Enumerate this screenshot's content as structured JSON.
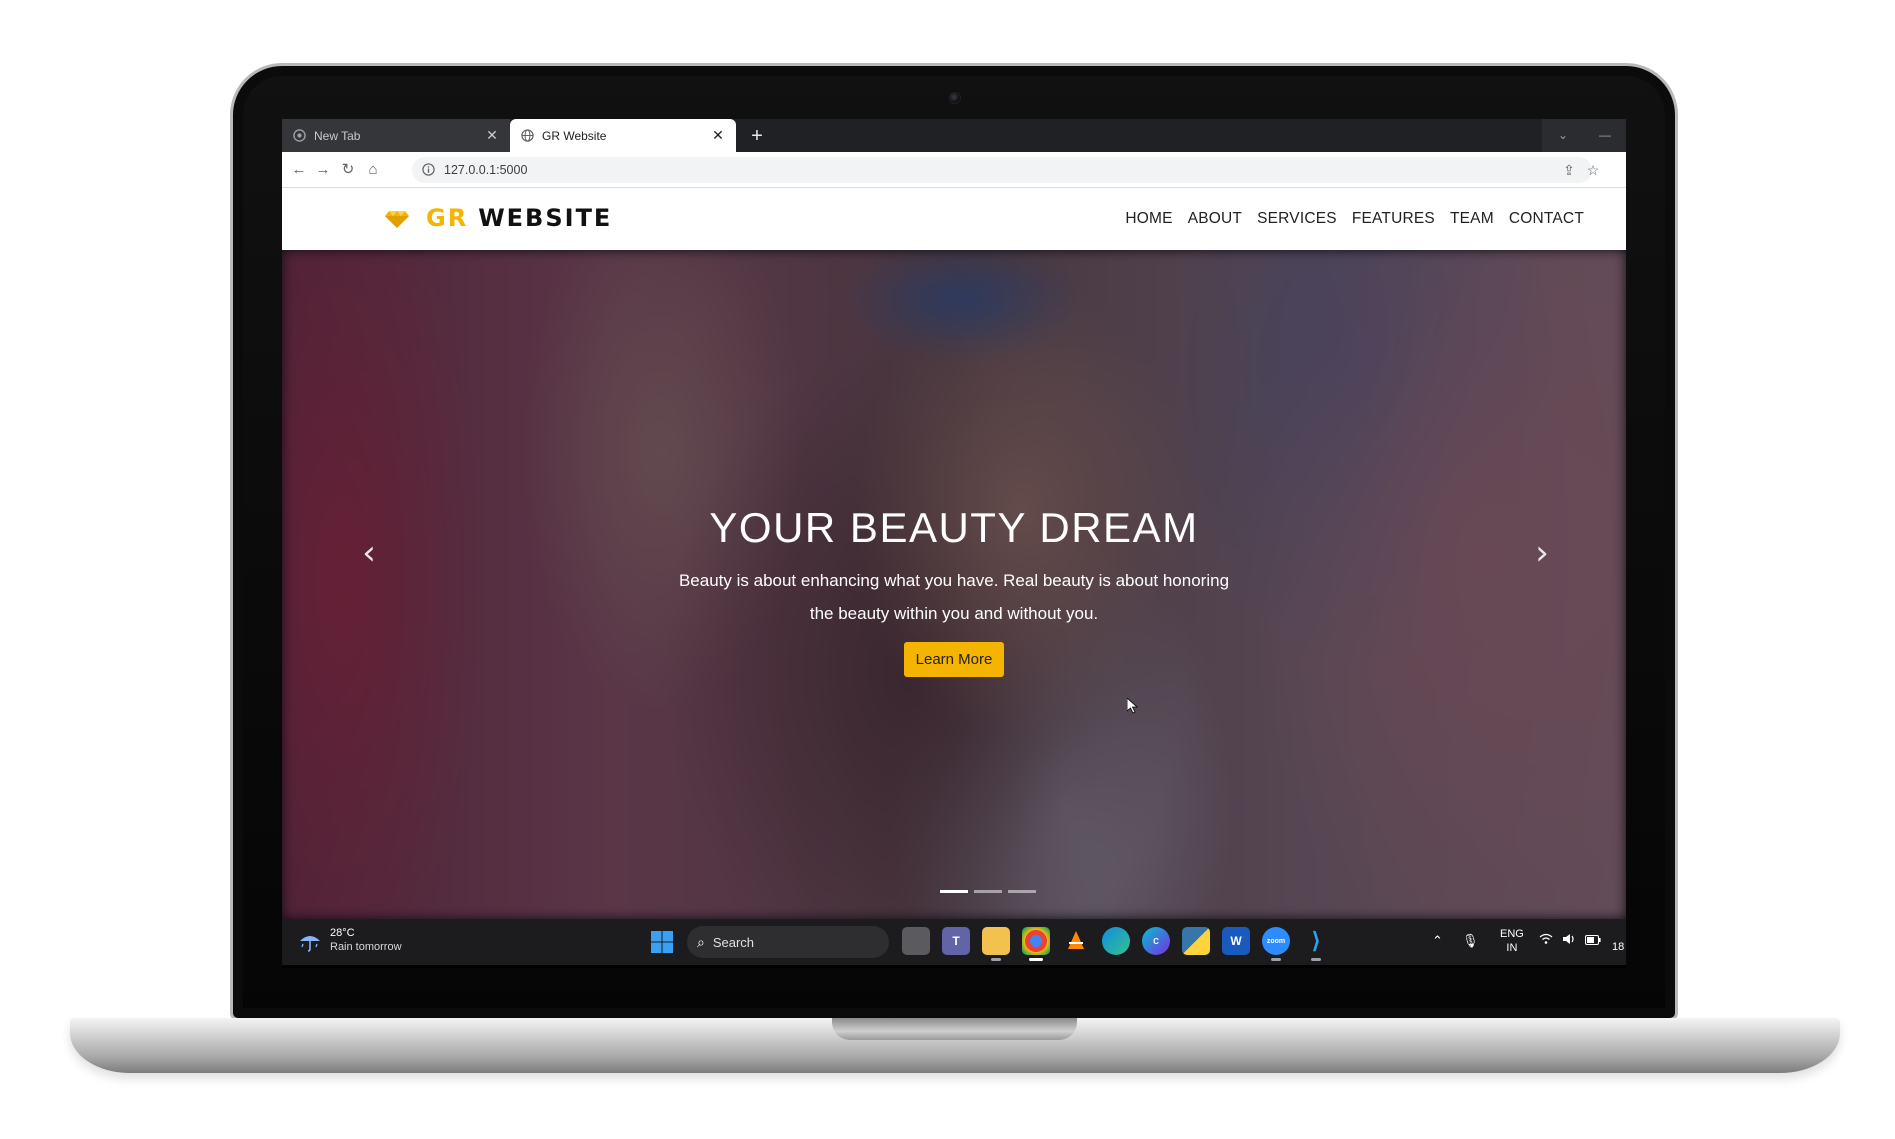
{
  "browser": {
    "tabs": [
      {
        "title": "New Tab",
        "active": false
      },
      {
        "title": "GR Website",
        "active": true
      }
    ],
    "url": "127.0.0.1:5000"
  },
  "site": {
    "brand_accent": "GR",
    "brand_main": "WEBSITE",
    "accent_color": "#f5b400",
    "nav": [
      "HOME",
      "ABOUT",
      "SERVICES",
      "FEATURES",
      "TEAM",
      "CONTACT"
    ]
  },
  "hero": {
    "title": "YOUR BEAUTY DREAM",
    "text": "Beauty is about enhancing what you have. Real beauty is about honoring the beauty within you and without you.",
    "button": "Learn More",
    "slide_count": 3,
    "active_slide": 1
  },
  "taskbar": {
    "weather_temp": "28°C",
    "weather_desc": "Rain tomorrow",
    "search_placeholder": "Search",
    "lang_line1": "ENG",
    "lang_line2": "IN",
    "clock": "18",
    "apps": [
      "task-view",
      "teams",
      "file-explorer",
      "chrome",
      "vlc",
      "edge",
      "canva",
      "python",
      "word",
      "zoom",
      "vscode"
    ]
  }
}
